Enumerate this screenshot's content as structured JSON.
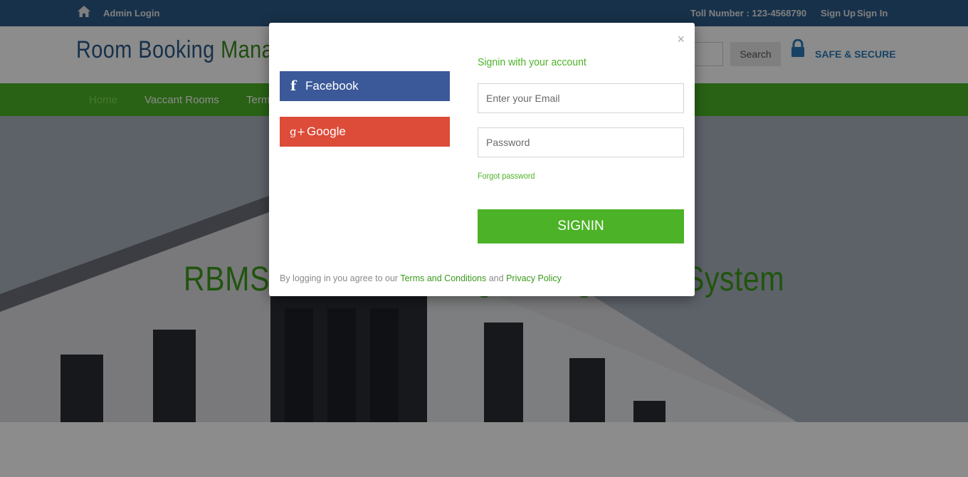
{
  "topbar": {
    "admin_login": "Admin Login",
    "toll_number": "Toll Number : 123-4568790",
    "sign_up": "Sign Up",
    "sign_in": "Sign In"
  },
  "header": {
    "brand_part1": "Room Booking ",
    "brand_part2": "Manage",
    "search_button": "Search",
    "secure_text": "SAFE & SECURE"
  },
  "nav": {
    "items": [
      "Home",
      "Vaccant Rooms",
      "Term"
    ],
    "active": "Home"
  },
  "hero": {
    "title": "RBMS - Room Booking Management System"
  },
  "modal": {
    "close": "×",
    "facebook": "Facebook",
    "google": "Google",
    "signin_title": "Signin with your account",
    "email_placeholder": "Enter your Email",
    "password_placeholder": "Password",
    "forgot_password": "Forgot password",
    "signin_button": "SIGNIN",
    "agree_prefix": "By logging in you agree to our ",
    "terms": "Terms and Conditions",
    "and": " and ",
    "privacy": "Privacy Policy"
  },
  "colors": {
    "topbar": "#2a5a87",
    "nav_green": "#4cb227",
    "facebook": "#3b5998",
    "google": "#dd4b39"
  }
}
